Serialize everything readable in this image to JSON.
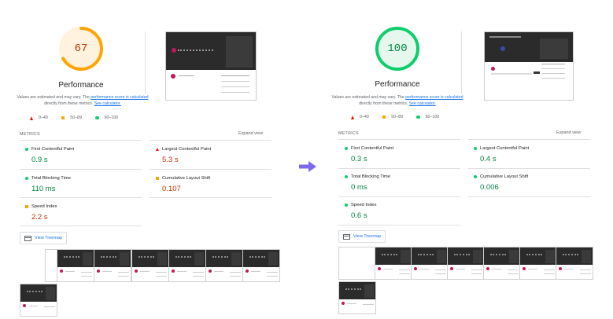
{
  "reports": [
    {
      "score": "67",
      "score_pct": 0.67,
      "score_color": "#ffa400",
      "title": "Performance",
      "desc_before": "Values are estimated and may vary. The ",
      "desc_link": "performance score is calculated",
      "desc_middle": " directly from these metrics. ",
      "desc_calc": "See calculator.",
      "legend": [
        "0–49",
        "50–89",
        "90–100"
      ],
      "metrics_label": "METRICS",
      "expand_label": "Expand view",
      "metrics": [
        {
          "name": "First Contentful Paint",
          "value": "0.9 s",
          "status": "good"
        },
        {
          "name": "Largest Contentful Paint",
          "value": "5.3 s",
          "status": "poor"
        },
        {
          "name": "Total Blocking Time",
          "value": "110 ms",
          "status": "good"
        },
        {
          "name": "Cumulative Layout Shift",
          "value": "0.107",
          "status": "average"
        },
        {
          "name": "Speed Index",
          "value": "2.2 s",
          "status": "average"
        }
      ],
      "treemap_label": "View Treemap"
    },
    {
      "score": "100",
      "score_pct": 1.0,
      "score_color": "#0cce6b",
      "title": "Performance",
      "desc_before": "Values are estimated and may vary. The ",
      "desc_link": "performance score is calculated",
      "desc_middle": " directly from these metrics. ",
      "desc_calc": "See calculator.",
      "legend": [
        "0–49",
        "50–89",
        "90–100"
      ],
      "metrics_label": "METRICS",
      "expand_label": "Expand view",
      "metrics": [
        {
          "name": "First Contentful Paint",
          "value": "0.3 s",
          "status": "good"
        },
        {
          "name": "Largest Contentful Paint",
          "value": "0.4 s",
          "status": "good"
        },
        {
          "name": "Total Blocking Time",
          "value": "0 ms",
          "status": "good"
        },
        {
          "name": "Cumulative Layout Shift",
          "value": "0.006",
          "status": "good"
        },
        {
          "name": "Speed Index",
          "value": "0.6 s",
          "status": "good"
        }
      ],
      "treemap_label": "View Treemap"
    }
  ],
  "colors": {
    "good": "#0cce6b",
    "average": "#ffa400",
    "poor": "#eb0f00",
    "arrow": "#7b68ee"
  }
}
